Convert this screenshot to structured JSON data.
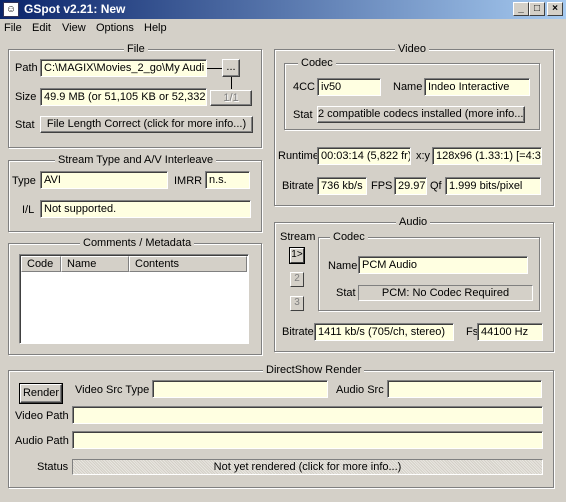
{
  "window": {
    "title": "GSpot v2.21: New",
    "app_icon": "gspot-face-icon",
    "minimize_icon": "_",
    "maximize_icon": "□",
    "close_icon": "×"
  },
  "menu": [
    "File",
    "Edit",
    "View",
    "Options",
    "Help"
  ],
  "file": {
    "legend": "File",
    "path_label": "Path",
    "path_value": "C:\\MAGIX\\Movies_2_go\\My Audi",
    "browse_label": "...",
    "size_label": "Size",
    "size_value": "49.9 MB (or 51,105 KB or 52,332,",
    "page_label": "1/1",
    "stat_label": "Stat",
    "stat_value": "File Length Correct (click for more info...)"
  },
  "stream_type": {
    "legend": "Stream Type and A/V Interleave",
    "type_label": "Type",
    "type_value": "AVI",
    "imrr_label": "IMRR",
    "imrr_value": "n.s.",
    "il_label": "I/L",
    "il_value": "Not supported."
  },
  "comments": {
    "legend": "Comments / Metadata",
    "columns": [
      "Code",
      "Name",
      "Contents"
    ],
    "rows": []
  },
  "video": {
    "legend": "Video",
    "codec_legend": "Codec",
    "fourcc_label": "4CC",
    "fourcc_value": "iv50",
    "name_label": "Name",
    "name_value": "Indeo Interactive",
    "stat_label": "Stat",
    "stat_value": "2 compatible codecs installed (more info...)",
    "runtime_label": "Runtime",
    "runtime_value": "00:03:14 (5,822 fr)",
    "xy_label": "x:y",
    "xy_value": "128x96 (1.33:1) [=4:3]",
    "bitrate_label": "Bitrate",
    "bitrate_value": "736 kb/s",
    "fps_label": "FPS",
    "fps_value": "29.97",
    "qf_label": "Qf",
    "qf_value": "1.999 bits/pixel"
  },
  "audio": {
    "legend": "Audio",
    "stream_label": "Stream",
    "streams": [
      "1>",
      "2",
      "3"
    ],
    "codec_legend": "Codec",
    "name_label": "Name",
    "name_value": "PCM Audio",
    "stat_label": "Stat",
    "stat_value": "PCM: No Codec Required",
    "bitrate_label": "Bitrate",
    "bitrate_value": "1411 kb/s (705/ch, stereo)",
    "fs_label": "Fs",
    "fs_value": "44100 Hz"
  },
  "directshow": {
    "legend": "DirectShow Render",
    "render_label": "Render",
    "video_src_type_label": "Video Src Type",
    "video_src_type_value": "",
    "audio_src_label": "Audio Src",
    "audio_src_value": "",
    "video_path_label": "Video Path",
    "video_path_value": "",
    "audio_path_label": "Audio Path",
    "audio_path_value": "",
    "status_label": "Status",
    "status_value": "Not yet rendered (click for more info...)"
  }
}
